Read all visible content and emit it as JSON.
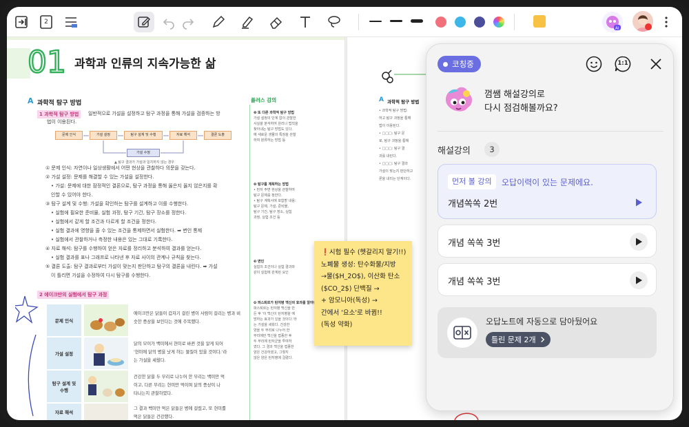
{
  "toolbar": {
    "left_icons": [
      "exit-page-icon",
      "page-number-icon",
      "list-menu-icon"
    ],
    "page_icon_label": "2",
    "tools": [
      "edit-icon",
      "undo-icon",
      "redo-icon",
      "pen-icon",
      "highlighter-icon",
      "eraser-icon",
      "text-icon",
      "lasso-icon"
    ],
    "line_widths": [
      "thin",
      "medium",
      "thick"
    ],
    "colors": [
      "#f0707c",
      "#3db6e8",
      "#4b4f9a",
      "rainbow"
    ],
    "sticky_color": "#f7c244"
  },
  "left_page": {
    "chapter_number": "01",
    "chapter_title": "과학과 인류의 지속가능한 삶",
    "section_a_letter": "A",
    "section_a_title": "과학적 탐구 방법",
    "item1_label": "1  과학적 탐구 방법",
    "item1_text": "일반적으로 가설을 설정하고 탐구 과정을 통해 가설을 검증하는 방",
    "item1_text2": "법이 이용된다.",
    "flow_steps": [
      "문제 인식",
      "가설 설정",
      "탐구 설계 및 수행",
      "자료 해석",
      "결론 도출"
    ],
    "flow_feedback": "가설 수정",
    "flow_caption": "▲ 탐구 결과가 가설과 일치하지 않는 경우",
    "lines": [
      "① 문제 인식: 자연이나 일상생활에서 어떤 현상을 관찰하다 의문을 갖는다.",
      "② 가설 설정: 문제를 해결할 수 있는 가설을 설정한다.",
      "• 가설: 문제에 대한 잠정적인 결론으로, 탐구 과정을 통해 옳은지 옳지 않은지를 확",
      "   인할 수 있어야 한다.",
      "③ 탐구 설계 및 수행: 가설을 확인하는 탐구를 설계하고 이를 수행한다.",
      "• 실험에 필요한 준비물, 실험 과정, 탐구 기간, 탐구 장소를 정한다.",
      "• 실험에서 같게 할 조건과 다르게 할 조건을 정한다.",
      "• 실험 결과에 영향을 줄 수 있는 조건을 통제하면서 실험한다. ➡ 변인 통제",
      "• 실험에서 관찰하거나 측정한 내용은 있는 그대로 기록한다.",
      "④ 자료 해석: 탐구를 수행하여 얻은 자료를 정리하고 분석하여 결과를 얻는다.",
      "• 실험 결과를 표나 그래프로 나타낸 후 자료 사이의 관계나 규칙을 찾는다.",
      "⑤ 결론 도출: 탐구 결과로부터 가설이 맞는지 판단하고 탐구의 결론을 내린다. ➡ 가설",
      "   이 틀리면 가설을 수정하여 다시 탐구를 수행한다."
    ],
    "item2_label": "2  에이크만의 실험에서 탐구 과정",
    "rows": [
      {
        "label": "문제 인식",
        "text": [
          "에이크만은 닭들이 갑자기 걸린 병이 사람이 걸리는 병과 비",
          "슷한 증상을 보인다는 것에 주목했다."
        ]
      },
      {
        "label": "가설 설정",
        "text": [
          "닭의 모이가 백미에서 현미로 바뀐 것을 알게 되어",
          "'현미에 닭의 병을 낫게 하는 물질이 있을 것이다.'라",
          "는 가설을 세웠다."
        ]
      },
      {
        "label": "탐구 설계 및 수행",
        "text": [
          "건강한 닭을 두 무리로 나누어 한 무리는 백미만 먹",
          "이고, 다른 무리는 현미만 먹이며 닭의 증상이 나",
          "타나는지 관찰하였다."
        ]
      },
      {
        "label": "자료 해석",
        "text": [
          "그 결과 백미만 먹은 닭들은 병에 걸렸고, 또 현미를",
          "먹은 닭들은 건강했다."
        ]
      }
    ],
    "side_heading": "플러스 강의",
    "side_blocks": [
      {
        "title": "❶ 또 다른 과학적 탐구 방법",
        "lines": [
          "가설 설정의 단계 없이 관찰한",
          "사실을 분석하여 원리나 법칙을",
          "찾아내는 탐구 방법도 있다.",
          "예 새로운 생물의 특징을 관찰",
          "하여 분류하는 방법 등"
        ]
      },
      {
        "title": "❷ 탐구를 계획하는 방법",
        "lines": [
          "• 먼저 주변 현상을 관찰하여",
          "  탐구 문제를 정한다.",
          "• 탐구 계획서에 포함할 내용:",
          "  탐구 문제, 가설, 준비물,",
          "  탐구 기간, 탐구 장소, 실험",
          "  과정, 실험 조건 등"
        ]
      },
      {
        "title": "❸ 변인",
        "lines": [
          "실험의 조건이나 실험 결과와",
          "같이 실험에 관계된 요인"
        ]
      },
      {
        "title": "❹ 파스퇴르가 탄저병 백신의 효과를 알아낸 과정",
        "lines": [
          "파스퇴르는 탄저병 백신을 만",
          "든 후 '이 백신이 탄저병을 예",
          "방하는 효과가 있을 것이다.'라",
          "는 가설을 세웠다. 건강한",
          "양을 두 무리로 나누어 한",
          "무리에만 백신을 접종한 후",
          "두 무리에 탄저균을 투여하",
          "였다. 그 결과 백신을 접종한",
          "양은 건강하였고, 그렇지",
          "않은 양은 탄저병에 걸렸다."
        ]
      }
    ]
  },
  "right_page": {
    "section_a_letter": "A",
    "section_a_title": "과학적 탐구 방법",
    "lines": [
      "• 과학적 탐구 방법:",
      "  하고 탐구 과정을 통해",
      "  법이 이용된다.",
      "• □□□: 탐구 문",
      "  로, 탐구 과정을 통해",
      "• □□□: 탐구 결",
      "  과를 내린다.",
      "• □□□: 탐구 결과",
      "  가설이 맞는지 판단하고",
      "  론을 내리는 단계이다."
    ]
  },
  "sticky_note": {
    "lines": [
      "❗시험 필수 (헷갈리지 말기!!)",
      "노폐물 생성: 탄수화물/지방",
      "→물($H_2O$), 이산화 탄소",
      "($CO_2$) 단백질 →",
      "+ 암모니아(독성) →",
      "간에서 '요소'로 바뀜!!",
      "(독성 약화)"
    ]
  },
  "panel": {
    "status_badge": "코칭중",
    "header_icons": [
      "smile-icon",
      "one-on-one-chat-icon",
      "close-icon"
    ],
    "one_to_one": "1:1",
    "greeting_line1": "껌쌤 해설강의로",
    "greeting_line2": "다시 점검해볼까요?",
    "lectures_label": "해설강의",
    "lectures_count": "3",
    "recommended": {
      "tag": "먼저 볼 강의",
      "note": "오답이력이 있는 문제에요.",
      "title": "개념쏙쏙 2번"
    },
    "lectures": [
      {
        "title": "개념 쏙쏙 3번"
      },
      {
        "title": "개념 쏙쏙 3번"
      }
    ],
    "wrong_note": {
      "text": "오답노트에 자동으로 담아뒀어요",
      "button": "틀린 문제 2개"
    }
  }
}
